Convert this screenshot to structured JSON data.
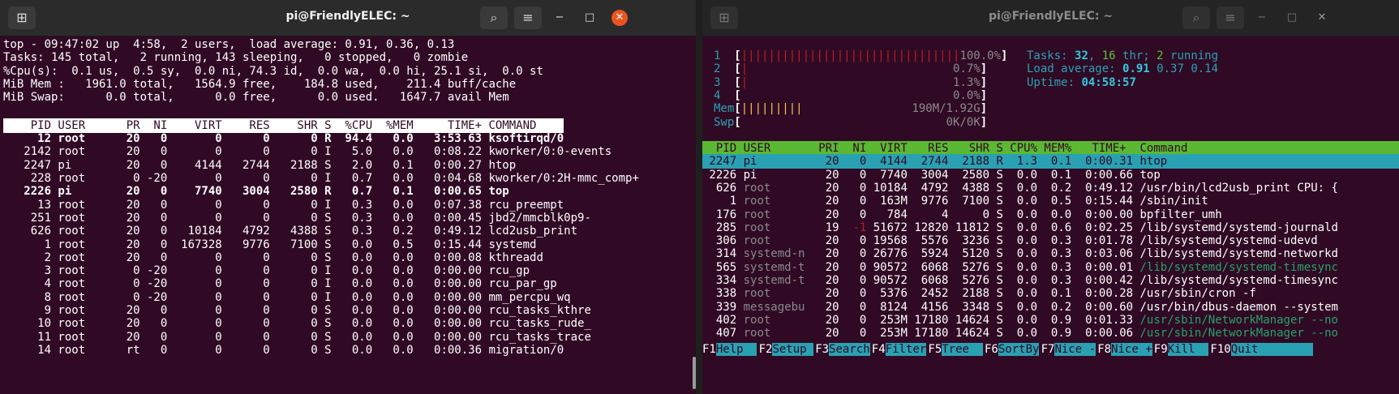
{
  "left_window": {
    "title": "pi@FriendlyELEC: ~",
    "new_tab_icon": "plus-tab-icon",
    "search_icon": "search-icon",
    "menu_icon": "hamburger-menu-icon",
    "minimize_glyph": "−",
    "maximize_glyph": "□",
    "close_glyph": "✕",
    "summary": [
      "top - 09:47:02 up  4:58,  2 users,  load average: 0.91, 0.36, 0.13",
      "Tasks: 145 total,   2 running, 143 sleeping,   0 stopped,   0 zombie",
      "%Cpu(s):  0.1 us,  0.5 sy,  0.0 ni, 74.3 id,  0.0 wa,  0.0 hi, 25.1 si,  0.0 st",
      "MiB Mem :   1961.0 total,   1564.9 free,    184.8 used,    211.4 buff/cache",
      "MiB Swap:      0.0 total,      0.0 free,      0.0 used.   1647.7 avail Mem"
    ],
    "header": "    PID USER      PR  NI    VIRT    RES    SHR S  %CPU  %MEM     TIME+ COMMAND    ",
    "rows": [
      {
        "text": "     12 root      20   0       0      0      0 R  94.4   0.0   3:53.63 ksoftirqd/0",
        "bold": true
      },
      {
        "text": "   2142 root      20   0       0      0      0 I   5.0   0.0   0:08.22 kworker/0:0-events",
        "bold": false
      },
      {
        "text": "   2247 pi        20   0    4144   2744   2188 S   2.0   0.1   0:00.27 htop",
        "bold": false
      },
      {
        "text": "    228 root       0 -20       0      0      0 I   0.7   0.0   0:04.68 kworker/0:2H-mmc_comp+",
        "bold": false
      },
      {
        "text": "   2226 pi        20   0    7740   3004   2580 R   0.7   0.1   0:00.65 top",
        "bold": true
      },
      {
        "text": "     13 root      20   0       0      0      0 I   0.3   0.0   0:07.38 rcu_preempt",
        "bold": false
      },
      {
        "text": "    251 root      20   0       0      0      0 S   0.3   0.0   0:00.45 jbd2/mmcblk0p9-",
        "bold": false
      },
      {
        "text": "    626 root      20   0   10184   4792   4388 S   0.3   0.2   0:49.12 lcd2usb_print",
        "bold": false
      },
      {
        "text": "      1 root      20   0  167328   9776   7100 S   0.0   0.5   0:15.44 systemd",
        "bold": false
      },
      {
        "text": "      2 root      20   0       0      0      0 S   0.0   0.0   0:00.08 kthreadd",
        "bold": false
      },
      {
        "text": "      3 root       0 -20       0      0      0 I   0.0   0.0   0:00.00 rcu_gp",
        "bold": false
      },
      {
        "text": "      4 root       0 -20       0      0      0 I   0.0   0.0   0:00.00 rcu_par_gp",
        "bold": false
      },
      {
        "text": "      8 root       0 -20       0      0      0 I   0.0   0.0   0:00.00 mm_percpu_wq",
        "bold": false
      },
      {
        "text": "      9 root      20   0       0      0      0 S   0.0   0.0   0:00.00 rcu_tasks_kthre",
        "bold": false
      },
      {
        "text": "     10 root      20   0       0      0      0 S   0.0   0.0   0:00.00 rcu_tasks_rude_",
        "bold": false
      },
      {
        "text": "     11 root      20   0       0      0      0 S   0.0   0.0   0:00.00 rcu_tasks_trace",
        "bold": false
      },
      {
        "text": "     14 root      rt   0       0      0      0 S   0.0   0.0   0:00.36 migration/0",
        "bold": false
      }
    ]
  },
  "right_window": {
    "title": "pi@FriendlyELEC: ~",
    "cpus": [
      {
        "num": "1",
        "bar": "||||||||||||||||||||||||||||||||",
        "pct": "100.0%"
      },
      {
        "num": "2",
        "bar": "|",
        "pct": "0.7%"
      },
      {
        "num": "3",
        "bar": "|",
        "pct": "1.3%"
      },
      {
        "num": "4",
        "bar": "",
        "pct": "0.0%"
      }
    ],
    "mem": {
      "label": "Mem",
      "bar": "|||||||||",
      "value": "190M/1.92G"
    },
    "swp": {
      "label": "Swp",
      "bar": "",
      "value": "0K/0K"
    },
    "tasks": {
      "label": "Tasks: ",
      "total": "32",
      "sep1": ", ",
      "thr": "16",
      "thr_label": " thr; ",
      "running": "2",
      "running_label": " running"
    },
    "load": {
      "label": "Load average: ",
      "v1": "0.91",
      "v2": "0.37",
      "v3": "0.14"
    },
    "uptime": {
      "label": "Uptime: ",
      "value": "04:58:57"
    },
    "header": "  PID USER       PRI  NI  VIRT   RES   SHR S CPU% MEM%   TIME+  Command                     ",
    "rows": [
      {
        "pid": " 2247",
        "user": " pi        ",
        "pri": "  20",
        "ni": "   0",
        "virt": "  4144",
        "res": "  2744",
        "shr": "  2188",
        "s": " R",
        "cpu": "  1.3",
        "mem": "  0.1",
        "time": "  0:00.31",
        "cmd": " htop",
        "sel": true,
        "green": false
      },
      {
        "pid": " 2226",
        "user": " pi        ",
        "pri": "  20",
        "ni": "   0",
        "virt": "  7740",
        "res": "  3004",
        "shr": "  2580",
        "s": " S",
        "cpu": "  0.0",
        "mem": "  0.1",
        "time": "  0:00.66",
        "cmd": " top",
        "sel": false,
        "green": false
      },
      {
        "pid": "  626",
        "user": " root      ",
        "pri": "  20",
        "ni": "   0",
        "virt": " 10184",
        "res": "  4792",
        "shr": "  4388",
        "s": " S",
        "cpu": "  0.0",
        "mem": "  0.2",
        "time": "  0:49.12",
        "cmd": " /usr/bin/lcd2usb_print CPU: {",
        "sel": false,
        "green": false
      },
      {
        "pid": "    1",
        "user": " root      ",
        "pri": "  20",
        "ni": "   0",
        "virt": "  163M",
        "res": "  9776",
        "shr": "  7100",
        "s": " S",
        "cpu": "  0.0",
        "mem": "  0.5",
        "time": "  0:15.44",
        "cmd": " /sbin/init",
        "sel": false,
        "green": false
      },
      {
        "pid": "  176",
        "user": " root      ",
        "pri": "  20",
        "ni": "   0",
        "virt": "   784",
        "res": "     4",
        "shr": "     0",
        "s": " S",
        "cpu": "  0.0",
        "mem": "  0.0",
        "time": "  0:00.00",
        "cmd": " bpfilter_umh",
        "sel": false,
        "green": false
      },
      {
        "pid": "  285",
        "user": " root      ",
        "pri": "  19",
        "ni": "  -1",
        "virt": " 51672",
        "res": " 12820",
        "shr": " 11812",
        "s": " S",
        "cpu": "  0.0",
        "mem": "  0.6",
        "time": "  0:02.25",
        "cmd": " /lib/systemd/systemd-journald",
        "sel": false,
        "green": false
      },
      {
        "pid": "  306",
        "user": " root      ",
        "pri": "  20",
        "ni": "   0",
        "virt": " 19568",
        "res": "  5576",
        "shr": "  3236",
        "s": " S",
        "cpu": "  0.0",
        "mem": "  0.3",
        "time": "  0:01.78",
        "cmd": " /lib/systemd/systemd-udevd",
        "sel": false,
        "green": false
      },
      {
        "pid": "  314",
        "user": " systemd-n ",
        "pri": "  20",
        "ni": "   0",
        "virt": " 26776",
        "res": "  5924",
        "shr": "  5120",
        "s": " S",
        "cpu": "  0.0",
        "mem": "  0.3",
        "time": "  0:03.06",
        "cmd": " /lib/systemd/systemd-networkd",
        "sel": false,
        "green": false
      },
      {
        "pid": "  565",
        "user": " systemd-t ",
        "pri": "  20",
        "ni": "   0",
        "virt": " 90572",
        "res": "  6068",
        "shr": "  5276",
        "s": " S",
        "cpu": "  0.0",
        "mem": "  0.3",
        "time": "  0:00.01",
        "cmd": " /lib/systemd/systemd-timesync",
        "sel": false,
        "green": true
      },
      {
        "pid": "  334",
        "user": " systemd-t ",
        "pri": "  20",
        "ni": "   0",
        "virt": " 90572",
        "res": "  6068",
        "shr": "  5276",
        "s": " S",
        "cpu": "  0.0",
        "mem": "  0.3",
        "time": "  0:00.42",
        "cmd": " /lib/systemd/systemd-timesync",
        "sel": false,
        "green": false
      },
      {
        "pid": "  338",
        "user": " root      ",
        "pri": "  20",
        "ni": "   0",
        "virt": "  5376",
        "res": "  2452",
        "shr": "  2188",
        "s": " S",
        "cpu": "  0.0",
        "mem": "  0.1",
        "time": "  0:00.28",
        "cmd": " /usr/sbin/cron -f",
        "sel": false,
        "green": false
      },
      {
        "pid": "  339",
        "user": " messagebu ",
        "pri": "  20",
        "ni": "   0",
        "virt": "  8124",
        "res": "  4156",
        "shr": "  3348",
        "s": " S",
        "cpu": "  0.0",
        "mem": "  0.2",
        "time": "  0:00.60",
        "cmd": " /usr/bin/dbus-daemon --system",
        "sel": false,
        "green": false
      },
      {
        "pid": "  402",
        "user": " root      ",
        "pri": "  20",
        "ni": "   0",
        "virt": "  253M",
        "res": " 17180",
        "shr": " 14624",
        "s": " S",
        "cpu": "  0.0",
        "mem": "  0.9",
        "time": "  0:01.33",
        "cmd": " /usr/sbin/NetworkManager --no",
        "sel": false,
        "green": true
      },
      {
        "pid": "  407",
        "user": " root      ",
        "pri": "  20",
        "ni": "   0",
        "virt": "  253M",
        "res": " 17180",
        "shr": " 14624",
        "s": " S",
        "cpu": "  0.0",
        "mem": "  0.9",
        "time": "  0:00.06",
        "cmd": " /usr/sbin/NetworkManager --no",
        "sel": false,
        "green": true
      }
    ],
    "fkeys": [
      {
        "key": "F1",
        "label": "Help  "
      },
      {
        "key": "F2",
        "label": "Setup "
      },
      {
        "key": "F3",
        "label": "Search"
      },
      {
        "key": "F4",
        "label": "Filter"
      },
      {
        "key": "F5",
        "label": "Tree  "
      },
      {
        "key": "F6",
        "label": "SortBy"
      },
      {
        "key": "F7",
        "label": "Nice -"
      },
      {
        "key": "F8",
        "label": "Nice +"
      },
      {
        "key": "F9",
        "label": "Kill  "
      },
      {
        "key": "F10",
        "label": "Quit        "
      }
    ]
  },
  "colors": {
    "terminal_bg": "#300a24",
    "htop_cyan": "#2aa1b3",
    "htop_green_header": "#5bb833",
    "close_orange": "#e95420"
  }
}
